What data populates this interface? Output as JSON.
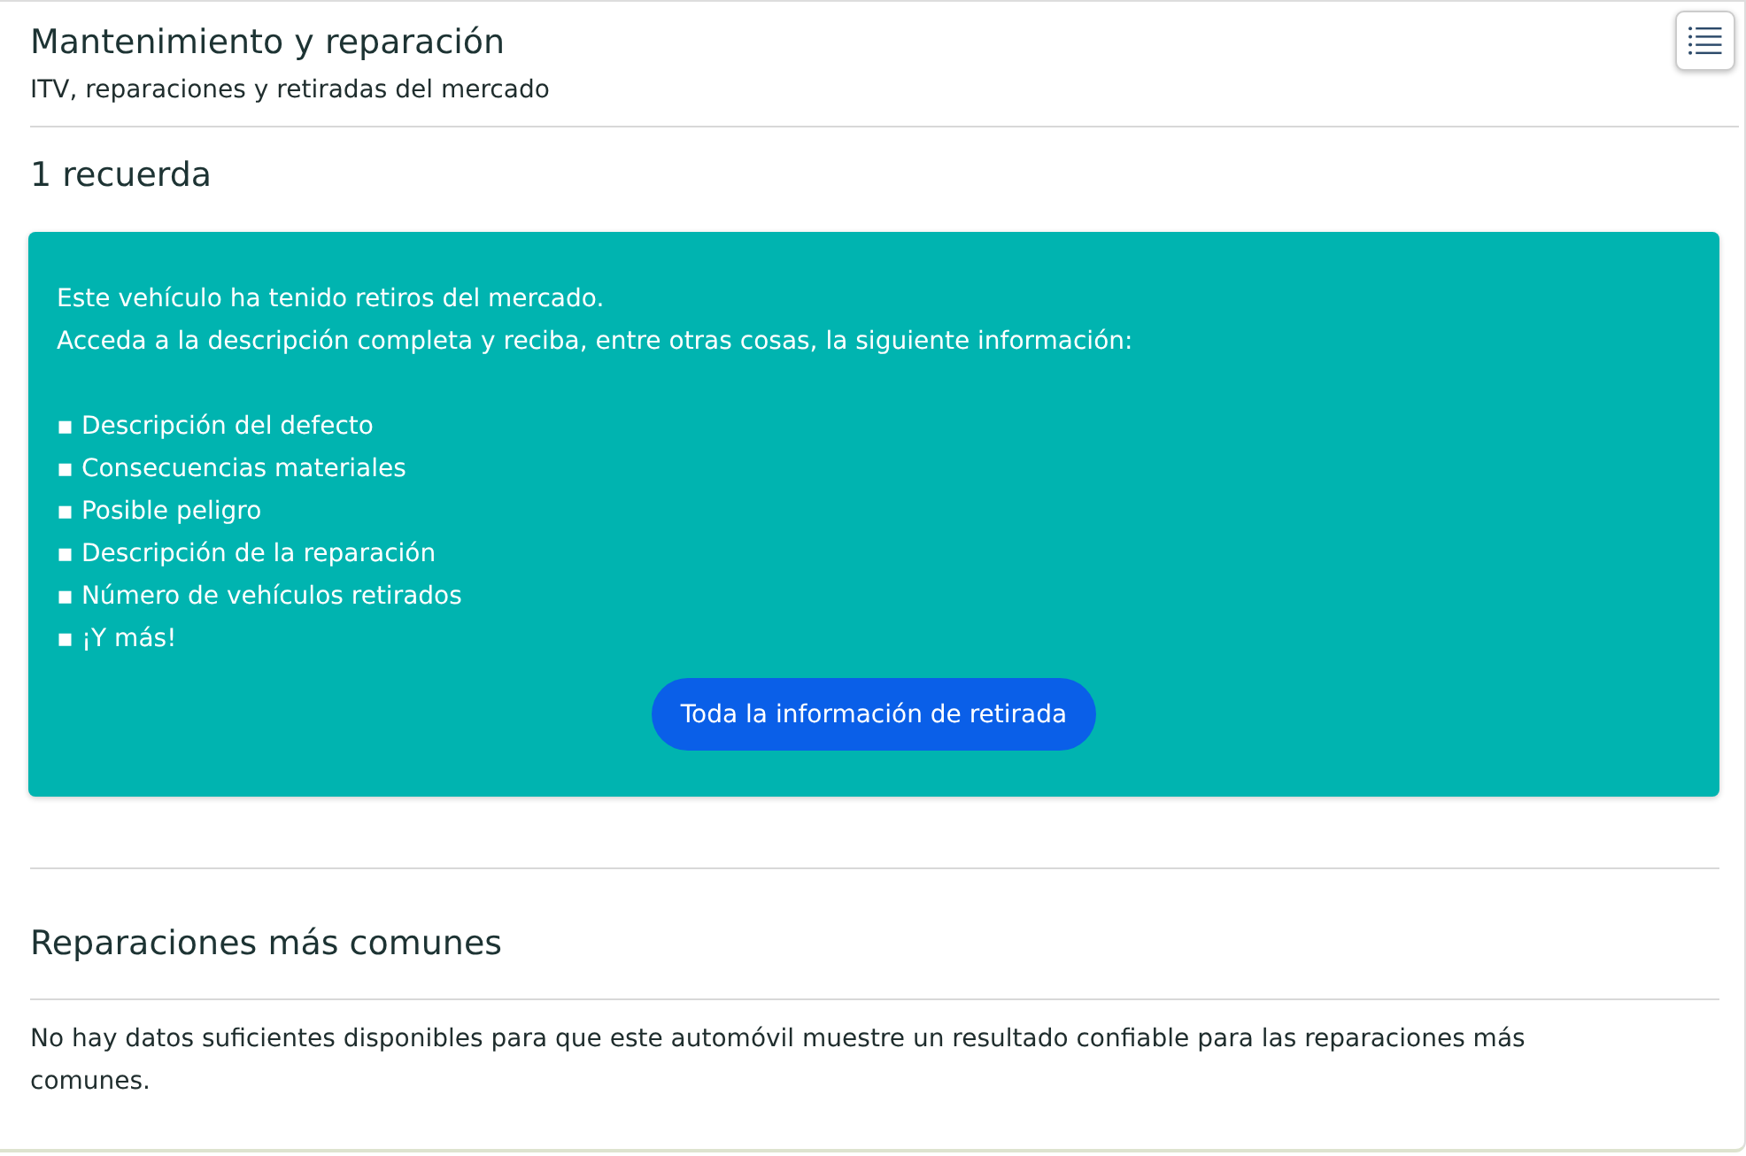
{
  "header": {
    "title": "Mantenimiento y reparación",
    "subtitle": "ITV, reparaciones y retiradas del mercado"
  },
  "recalls": {
    "heading": "1 recuerda",
    "intro": [
      "Este vehículo ha tenido retiros del mercado.",
      "Acceda a la descripción completa y reciba, entre otras cosas, la siguiente información:"
    ],
    "items": [
      "▪ Descripción del defecto",
      "▪ Consecuencias materiales",
      "▪ Posible peligro",
      "▪ Descripción de la reparación",
      "▪ Número de vehículos retirados",
      "▪ ¡Y más!"
    ],
    "button": "Toda la información de retirada"
  },
  "common_repairs": {
    "heading": "Reparaciones más comunes",
    "text": "No hay datos suficientes disponibles para que este automóvil muestre un resultado confiable para las reparaciones más comunes."
  }
}
